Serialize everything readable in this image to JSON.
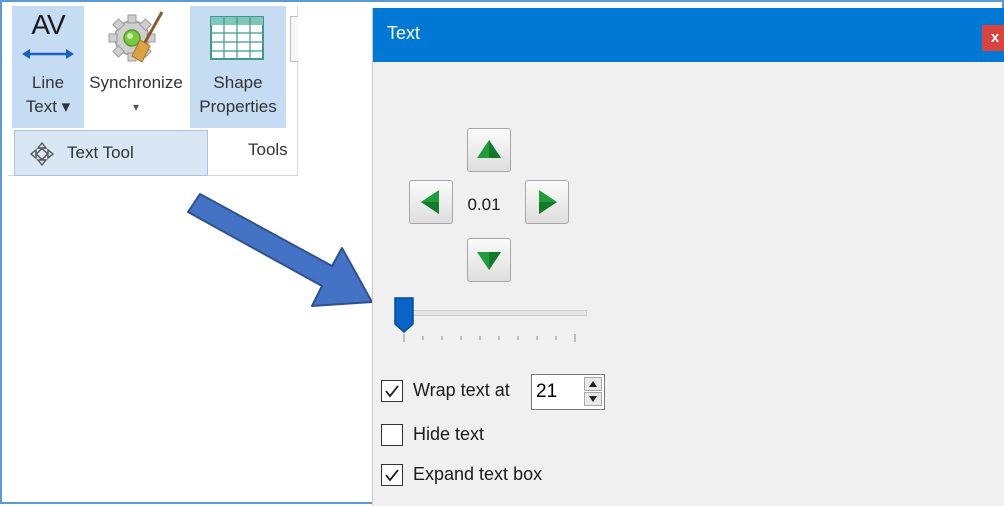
{
  "ribbon": {
    "line_text": {
      "icon_text": "AV",
      "label_line1": "Line",
      "label_line2": "Text ▾"
    },
    "synchronize": {
      "label": "Synchronize",
      "dropdown": "▾"
    },
    "shape_properties": {
      "label_line1": "Shape",
      "label_line2": "Properties"
    },
    "text_tool": {
      "label": "Text Tool"
    },
    "group_label": "Tools"
  },
  "dialog": {
    "title": "Text",
    "close_label": "x",
    "step_value": "0.01",
    "slider": {
      "position_fraction": 0.0,
      "tick_count": 10
    },
    "wrap_text": {
      "label": "Wrap text at",
      "checked": true,
      "value": "21"
    },
    "hide_text": {
      "label": "Hide text",
      "checked": false
    },
    "expand_text_box": {
      "label": "Expand text box",
      "checked": true
    }
  },
  "colors": {
    "titlebar": "#0078d4",
    "close_button": "#d9443f",
    "arrow": "#4472c4",
    "nav_arrow": "#1f9d3a",
    "frame_border": "#5b9bd5"
  },
  "icons": [
    "av-icon",
    "gear-broom-icon",
    "table-grid-icon",
    "text-tool-icon",
    "arrow-up-icon",
    "arrow-left-icon",
    "arrow-right-icon",
    "arrow-down-icon",
    "checkmark-icon"
  ]
}
